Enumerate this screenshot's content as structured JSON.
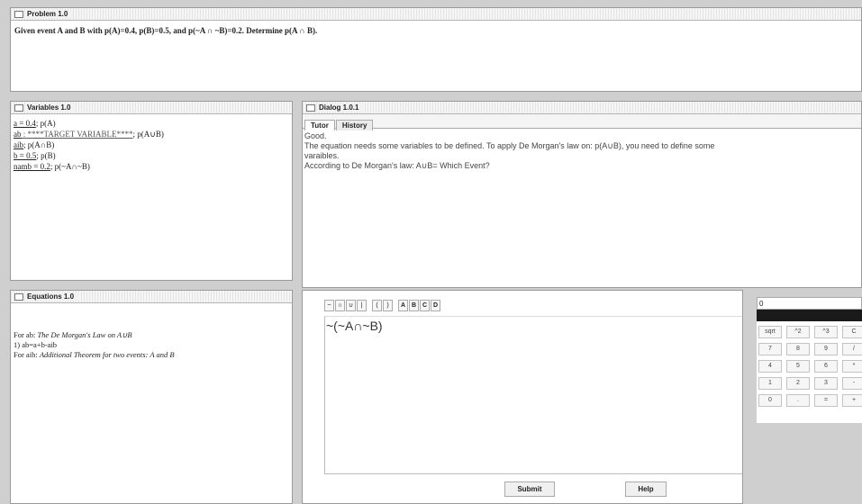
{
  "problem": {
    "title": "Problem 1.0",
    "text": "Given event A and B with p(A)=0.4, p(B)=0.5, and p(~A ∩ ~B)=0.2. Determine p(A ∩ B)."
  },
  "variables": {
    "title": "Variables 1.0",
    "rows": [
      {
        "name": "a = 0.4",
        "desc": "; p(A)"
      },
      {
        "name": "ab",
        "value": " : ****TARGET VARIABLE****",
        "desc": "; p(A∪B)"
      },
      {
        "name": "aib",
        "desc": "; p(A∩B)"
      },
      {
        "name": "b = 0.5",
        "desc": "; p(B)"
      },
      {
        "name": "namb = 0.2",
        "desc": "; p(~A∩~B)"
      }
    ]
  },
  "equations": {
    "title": "Equations 1.0",
    "l1_prefix": "For ab: ",
    "l1_italic": "The De Morgan's Law on A∪B",
    "l2": "1) ab=a+b-aib",
    "l3_prefix": "For aib: ",
    "l3_italic": "Additional Theorem for two events: A and B"
  },
  "dialog": {
    "title": "Dialog 1.0.1",
    "tabs": [
      "Tutor",
      "History"
    ],
    "lines": [
      "Good.",
      "The equation needs some variables to be defined. To apply De Morgan's law on: p(A∪B), you need to define some",
      "varaibles.",
      "According to De Morgan's law: A∪B= Which Event?"
    ]
  },
  "editor": {
    "toolbar": [
      "~",
      "∩",
      "∪",
      "|",
      "(",
      ")",
      "A",
      "B",
      "C",
      "D"
    ],
    "expression": "~(~A∩~B)",
    "submit": "Submit",
    "help": "Help"
  },
  "calculator": {
    "display": "0",
    "keys": [
      "sqrt",
      "^2",
      "^3",
      "C",
      "7",
      "8",
      "9",
      "/",
      "4",
      "5",
      "6",
      "*",
      "1",
      "2",
      "3",
      "-",
      "0",
      ".",
      "=",
      "+"
    ]
  }
}
